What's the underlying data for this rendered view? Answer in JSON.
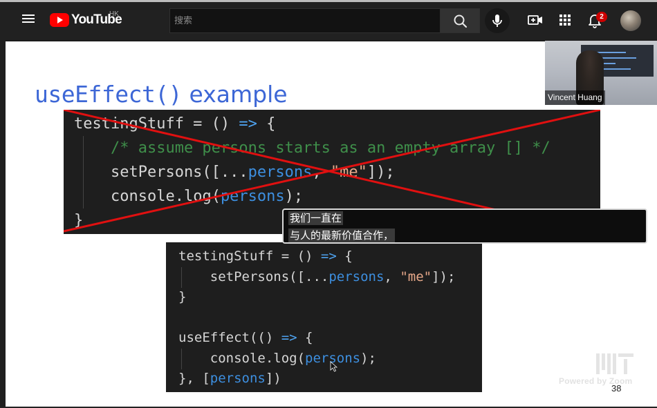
{
  "header": {
    "logo_text": "YouTube",
    "region": "HK",
    "search_placeholder": "搜索",
    "notification_count": "2",
    "icons": {
      "menu": "hamburger-menu-icon",
      "search": "search-icon",
      "voice": "microphone-icon",
      "create": "video-camera-plus-icon",
      "apps": "apps-grid-icon",
      "notifications": "bell-icon"
    },
    "colors": {
      "brand": "#ff0000",
      "badge": "#cc0000",
      "bar": "#212121"
    }
  },
  "slide": {
    "title_code": "useEffect()",
    "title_text": " example",
    "crossed_code": [
      [
        {
          "t": "testingStuff = () ",
          "c": "c-white"
        },
        {
          "t": "=>",
          "c": "c-op"
        },
        {
          "t": " {",
          "c": "c-white"
        }
      ],
      [
        {
          "t": "    /* assume persons starts as an empty array [] */",
          "c": "c-cmt"
        }
      ],
      [
        {
          "t": "    setPersons([...",
          "c": "c-white"
        },
        {
          "t": "persons",
          "c": "c-blue"
        },
        {
          "t": ", ",
          "c": "c-white"
        },
        {
          "t": "\"me\"",
          "c": "c-str"
        },
        {
          "t": "]);",
          "c": "c-white"
        }
      ],
      [
        {
          "t": "    console.",
          "c": "c-white"
        },
        {
          "t": "log(",
          "c": "c-white"
        },
        {
          "t": "persons",
          "c": "c-blue"
        },
        {
          "t": ");",
          "c": "c-white"
        }
      ],
      [
        {
          "t": "}",
          "c": "c-white"
        }
      ]
    ],
    "correct_code": [
      [
        {
          "t": "testingStuff = () ",
          "c": "c-white"
        },
        {
          "t": "=>",
          "c": "c-op"
        },
        {
          "t": " {",
          "c": "c-white"
        }
      ],
      [
        {
          "t": "    setPersons([...",
          "c": "c-white"
        },
        {
          "t": "persons",
          "c": "c-blue"
        },
        {
          "t": ", ",
          "c": "c-white"
        },
        {
          "t": "\"me\"",
          "c": "c-str"
        },
        {
          "t": "]);",
          "c": "c-white"
        }
      ],
      [
        {
          "t": "}",
          "c": "c-white"
        }
      ],
      [
        {
          "t": "",
          "c": "c-white"
        }
      ],
      [
        {
          "t": "useEffect(() ",
          "c": "c-white"
        },
        {
          "t": "=>",
          "c": "c-op"
        },
        {
          "t": " {",
          "c": "c-white"
        }
      ],
      [
        {
          "t": "    console.log(",
          "c": "c-white"
        },
        {
          "t": "persons",
          "c": "c-blue"
        },
        {
          "t": ");",
          "c": "c-white"
        }
      ],
      [
        {
          "t": "}, [",
          "c": "c-white"
        },
        {
          "t": "persons",
          "c": "c-blue"
        },
        {
          "t": "])",
          "c": "c-white"
        }
      ]
    ],
    "page_number": "38",
    "colors": {
      "title": "#3d67d6",
      "strike": "#e01010",
      "code_bg": "#1e1e1e"
    }
  },
  "captions": {
    "line1": "我们一直在",
    "line2": "与人的最新价值合作，"
  },
  "webcam": {
    "name": "Vincent Huang"
  },
  "overlay": {
    "powered_by": "Powered by Zoom"
  }
}
